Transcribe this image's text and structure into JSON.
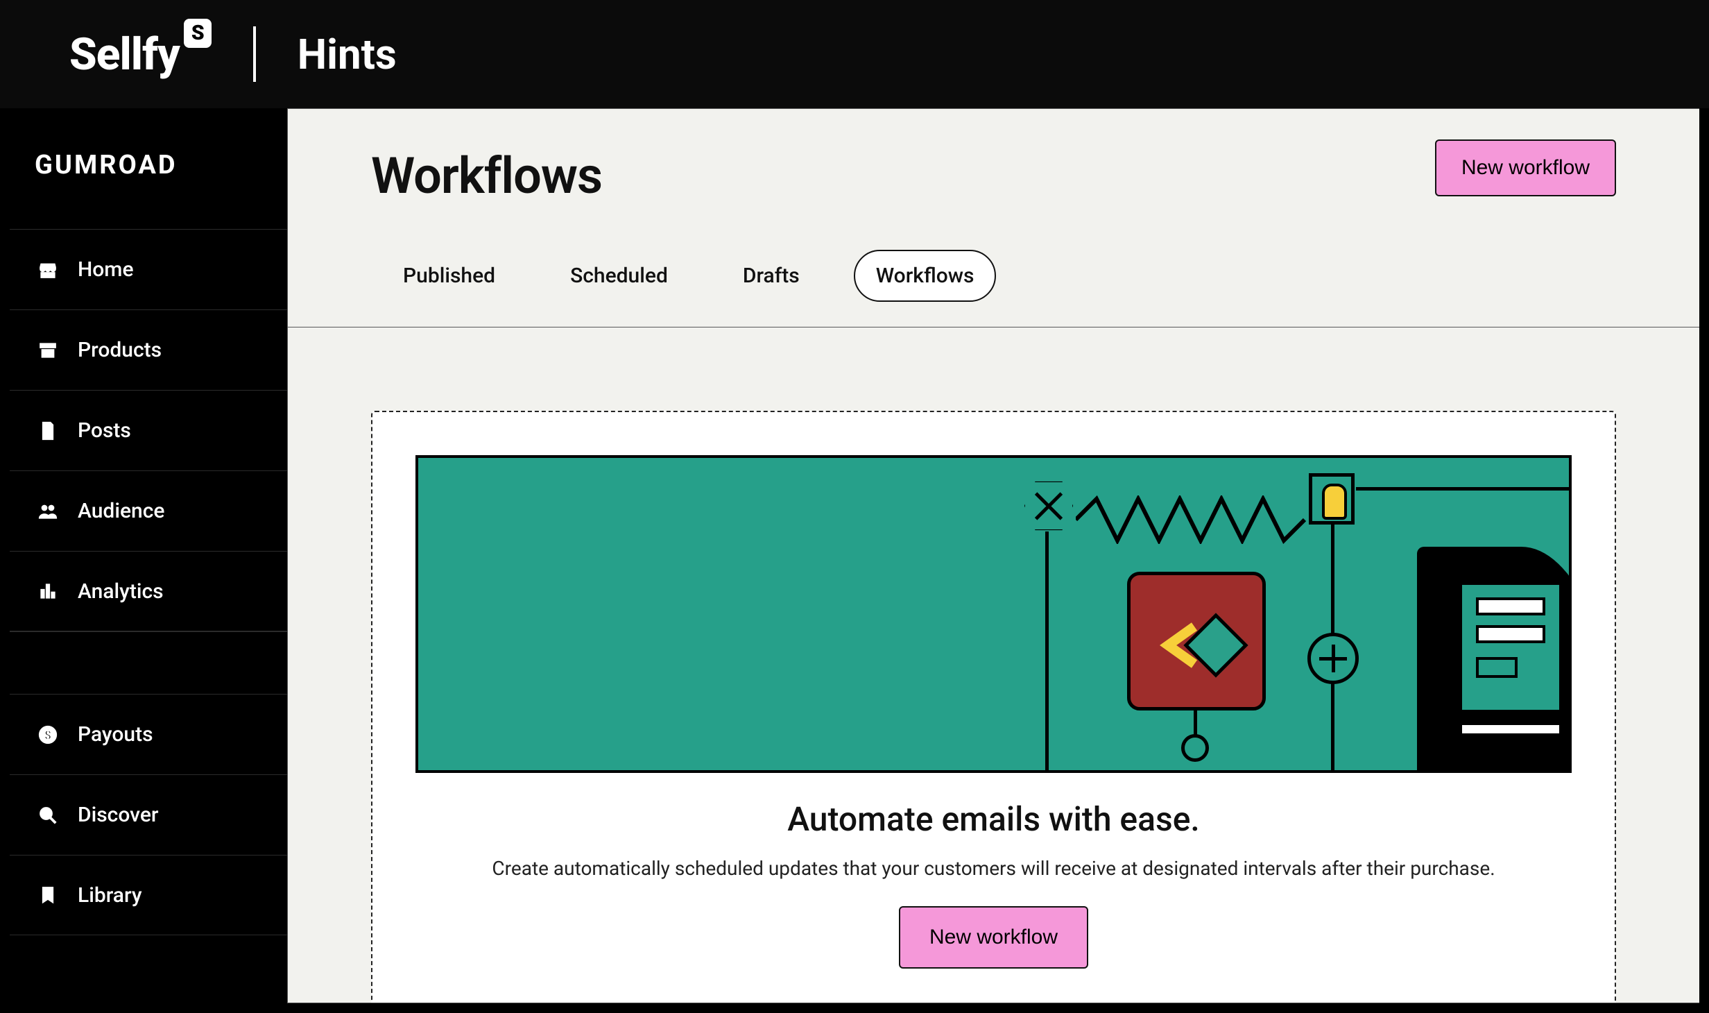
{
  "topbar": {
    "brand": "Sellfy",
    "brand_badge": "S",
    "section": "Hints"
  },
  "sidebar": {
    "logo": "GUMROAD",
    "group1": [
      {
        "label": "Home",
        "icon": "store-icon"
      },
      {
        "label": "Products",
        "icon": "archive-icon"
      },
      {
        "label": "Posts",
        "icon": "file-icon"
      },
      {
        "label": "Audience",
        "icon": "people-icon"
      },
      {
        "label": "Analytics",
        "icon": "bars-icon"
      }
    ],
    "group2": [
      {
        "label": "Payouts",
        "icon": "dollar-icon"
      },
      {
        "label": "Discover",
        "icon": "search-icon"
      },
      {
        "label": "Library",
        "icon": "bookmark-icon"
      }
    ]
  },
  "page": {
    "title": "Workflows",
    "primary_button": "New workflow"
  },
  "tabs": [
    {
      "label": "Published",
      "active": false
    },
    {
      "label": "Scheduled",
      "active": false
    },
    {
      "label": "Drafts",
      "active": false
    },
    {
      "label": "Workflows",
      "active": true
    }
  ],
  "empty_state": {
    "title": "Automate emails with ease.",
    "subtitle": "Create automatically scheduled updates that your customers will receive at designated intervals after their purchase.",
    "cta": "New workflow"
  }
}
